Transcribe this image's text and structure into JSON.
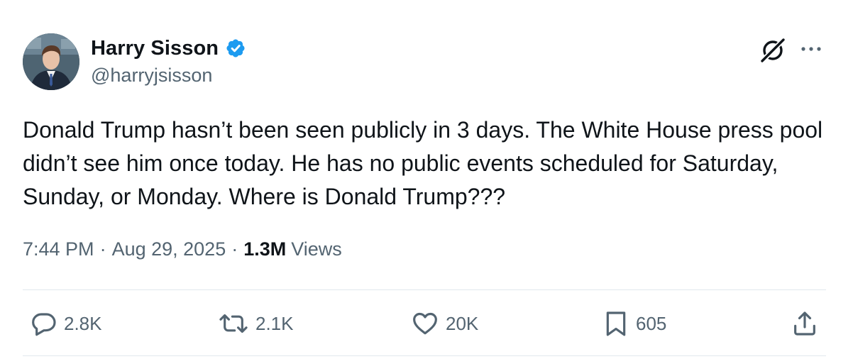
{
  "author": {
    "display_name": "Harry Sisson",
    "handle": "@harryjsisson",
    "verified": true,
    "verified_color": "#1d9bf0"
  },
  "tweet": {
    "text": "Donald Trump hasn’t been seen publicly in 3 days. The White House press pool didn’t see him once today. He has no public events scheduled for Saturday, Sunday, or Monday. Where is Donald Trump???"
  },
  "meta": {
    "time": "7:44 PM",
    "separator": "·",
    "date": "Aug 29, 2025",
    "views_count": "1.3M",
    "views_label": "Views"
  },
  "actions": {
    "replies": "2.8K",
    "reposts": "2.1K",
    "likes": "20K",
    "bookmarks": "605"
  },
  "icons": {
    "grok": "grok-icon",
    "more": "more-icon",
    "reply": "reply-icon",
    "repost": "repost-icon",
    "like": "heart-icon",
    "bookmark": "bookmark-icon",
    "share": "share-icon"
  },
  "colors": {
    "text_primary": "#0f1419",
    "text_secondary": "#536471",
    "divider": "#e1e8ed",
    "accent": "#1d9bf0"
  }
}
